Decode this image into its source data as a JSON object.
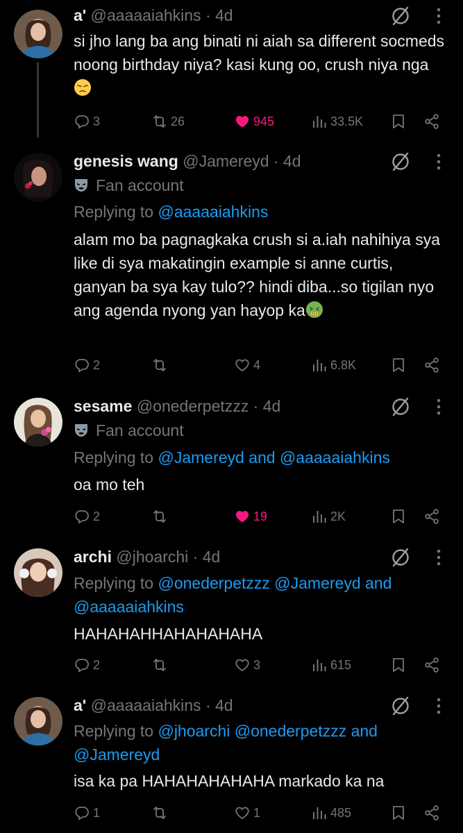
{
  "tweets": [
    {
      "name": "a'",
      "handle": "@aaaaaiahkins",
      "sep": "·",
      "time": "4d",
      "badge": "",
      "replying_prefix": "",
      "replying_mentions": "",
      "text": "si jho lang ba ang binati ni aiah sa different socmeds noong birthday niya? kasi kung oo, crush niya nga ",
      "emoji": "pensive-face-icon",
      "replies": "3",
      "retweets": "26",
      "likes": "945",
      "liked": true,
      "views": "33.5K"
    },
    {
      "name": "genesis wang",
      "handle": "@Jamereyd",
      "sep": "·",
      "time": "4d",
      "badge": "Fan account",
      "replying_prefix": "Replying to ",
      "replying_mentions": "@aaaaaiahkins",
      "text": "alam mo ba pagnagkaka crush si a.iah nahihiya sya like di sya makatingin example si anne curtis, ganyan ba sya kay tulo?? hindi diba...so tigilan nyo ang agenda nyong yan hayop ka",
      "emoji": "nauseated-face-icon",
      "replies": "2",
      "retweets": "",
      "likes": "4",
      "liked": false,
      "views": "6.8K"
    },
    {
      "name": "sesame",
      "handle": "@onederpetzzz",
      "sep": "·",
      "time": "4d",
      "badge": "Fan account",
      "replying_prefix": "Replying to ",
      "replying_mentions": "@Jamereyd and @aaaaaiahkins",
      "text": "oa mo teh",
      "replies": "2",
      "retweets": "",
      "likes": "19",
      "liked": true,
      "views": "2K"
    },
    {
      "name": "archi",
      "handle": "@jhoarchi",
      "sep": "·",
      "time": "4d",
      "badge": "",
      "replying_prefix": "Replying to ",
      "replying_mentions": "@onederpetzzz @Jamereyd and @aaaaaiahkins",
      "text": "HAHAHAHHAHAHAHAHA",
      "replies": "2",
      "retweets": "",
      "likes": "3",
      "liked": false,
      "views": "615"
    },
    {
      "name": "a'",
      "handle": "@aaaaaiahkins",
      "sep": "·",
      "time": "4d",
      "badge": "",
      "replying_prefix": "Replying to ",
      "replying_mentions": "@jhoarchi @onederpetzzz and @Jamereyd",
      "text": "isa ka pa HAHAHAHAHAHA markado ka na",
      "replies": "1",
      "retweets": "",
      "likes": "1",
      "liked": false,
      "views": "485"
    }
  ],
  "colors": {
    "background": "#000000",
    "text": "#e7e9ea",
    "muted": "#71767b",
    "mention": "#1d9bf0",
    "like": "#f91880"
  }
}
